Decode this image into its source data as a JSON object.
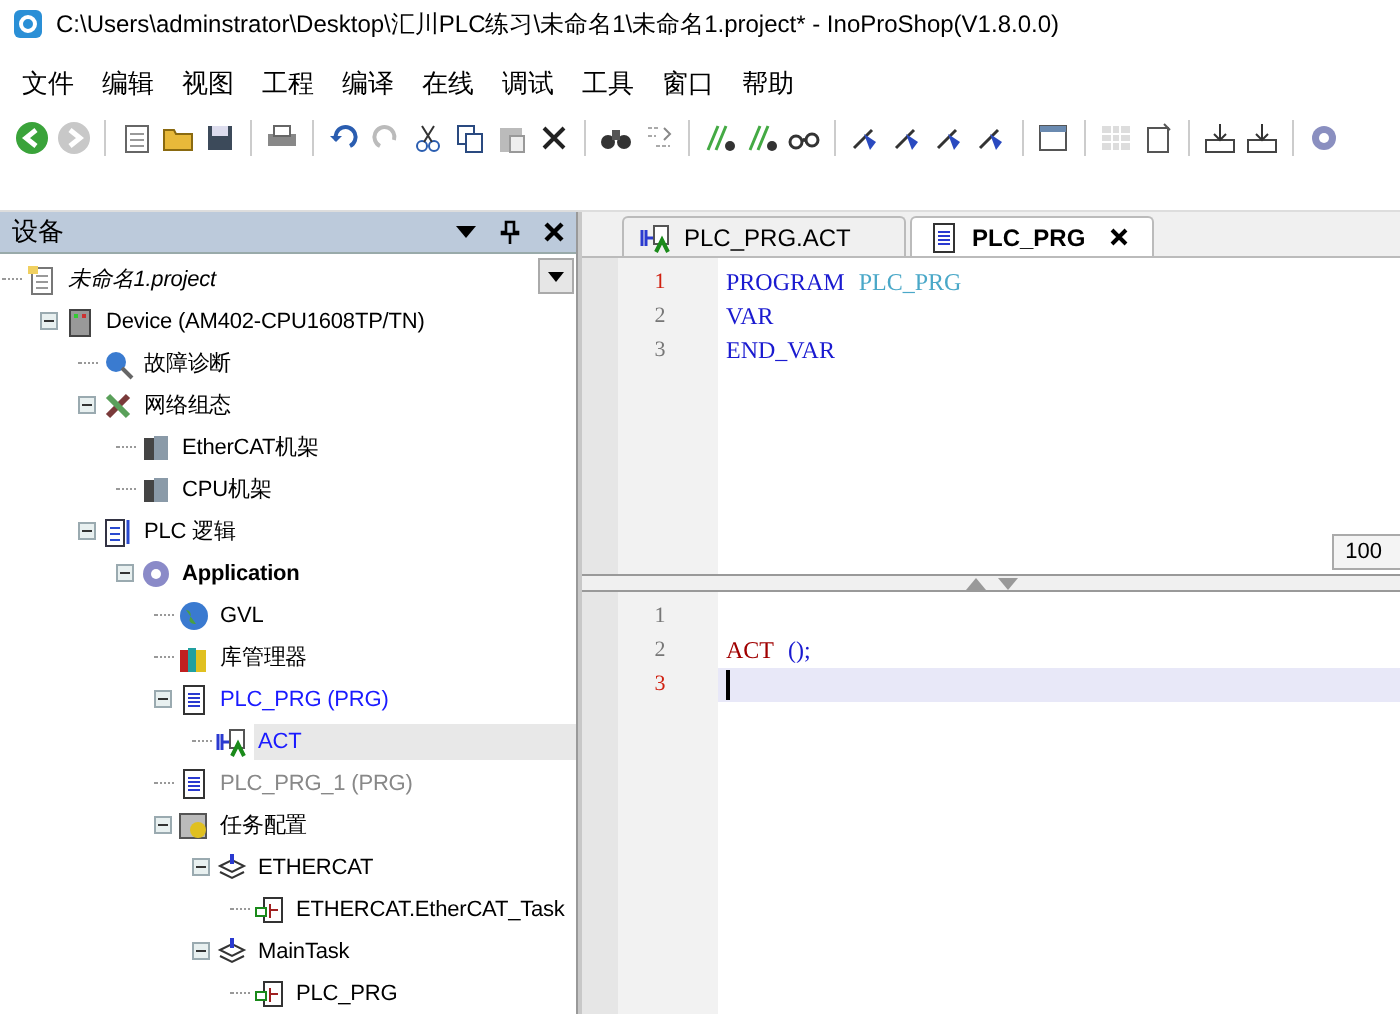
{
  "window": {
    "title": "C:\\Users\\adminstrator\\Desktop\\汇川PLC练习\\未命名1\\未命名1.project* - InoProShop(V1.8.0.0)"
  },
  "menu": [
    "文件",
    "编辑",
    "视图",
    "工程",
    "编译",
    "在线",
    "调试",
    "工具",
    "窗口",
    "帮助"
  ],
  "devices_panel": {
    "title": "设备",
    "tree": [
      {
        "label": "未命名1.project",
        "kind": "project",
        "selected": false,
        "children": [
          {
            "label": "Device (AM402-CPU1608TP/TN)",
            "kind": "device",
            "selected": false,
            "expanded": true,
            "children": [
              {
                "label": "故障诊断",
                "kind": "diagnosis",
                "selected": false
              },
              {
                "label": "网络组态",
                "kind": "network",
                "selected": false,
                "expanded": true,
                "children": [
                  {
                    "label": "EtherCAT机架",
                    "kind": "rack",
                    "selected": false
                  },
                  {
                    "label": "CPU机架",
                    "kind": "rack",
                    "selected": false
                  }
                ]
              },
              {
                "label": "PLC 逻辑",
                "kind": "logic",
                "selected": false,
                "expanded": true,
                "children": [
                  {
                    "label": "Application",
                    "kind": "application",
                    "selected": false,
                    "expanded": true,
                    "children": [
                      {
                        "label": "GVL",
                        "kind": "globals",
                        "selected": false
                      },
                      {
                        "label": "库管理器",
                        "kind": "library",
                        "selected": false
                      },
                      {
                        "label": "PLC_PRG (PRG)",
                        "kind": "pou",
                        "selected": false,
                        "unused": false,
                        "expanded": true,
                        "children": [
                          {
                            "label": "ACT",
                            "kind": "action",
                            "selected": true
                          }
                        ]
                      },
                      {
                        "label": "PLC_PRG_1 (PRG)",
                        "kind": "pou",
                        "selected": false,
                        "unused": true
                      },
                      {
                        "label": "任务配置",
                        "kind": "taskconfig",
                        "selected": false,
                        "expanded": true,
                        "children": [
                          {
                            "label": "ETHERCAT",
                            "kind": "task",
                            "selected": false,
                            "expanded": true,
                            "children": [
                              {
                                "label": "ETHERCAT.EtherCAT_Task",
                                "kind": "call",
                                "selected": false
                              }
                            ]
                          },
                          {
                            "label": "MainTask",
                            "kind": "task",
                            "selected": false,
                            "expanded": true,
                            "children": [
                              {
                                "label": "PLC_PRG",
                                "kind": "call",
                                "selected": false
                              }
                            ]
                          }
                        ]
                      }
                    ]
                  }
                ]
              }
            ]
          }
        ]
      }
    ]
  },
  "editor": {
    "tabs": [
      {
        "label": "PLC_PRG.ACT",
        "kind": "action",
        "selected": false
      },
      {
        "label": "PLC_PRG",
        "kind": "pou",
        "selected": true
      }
    ],
    "declaration": [
      {
        "number": "1",
        "tokens": [
          {
            "text": "PROGRAM",
            "kind": "keyword"
          },
          {
            "text": "PLC_PRG",
            "kind": "name"
          }
        ]
      },
      {
        "number": "2",
        "tokens": [
          {
            "text": "VAR",
            "kind": "keyword"
          }
        ]
      },
      {
        "number": "3",
        "tokens": [
          {
            "text": "END_VAR",
            "kind": "keyword"
          }
        ]
      }
    ],
    "zoom": "100",
    "body": [
      {
        "number": "1",
        "current": false
      },
      {
        "number": "2",
        "current": false,
        "tokens": [
          {
            "text": "ACT",
            "kind": "call"
          },
          {
            "text": "();",
            "kind": "keyword"
          }
        ]
      },
      {
        "number": "3",
        "current": true
      }
    ]
  }
}
